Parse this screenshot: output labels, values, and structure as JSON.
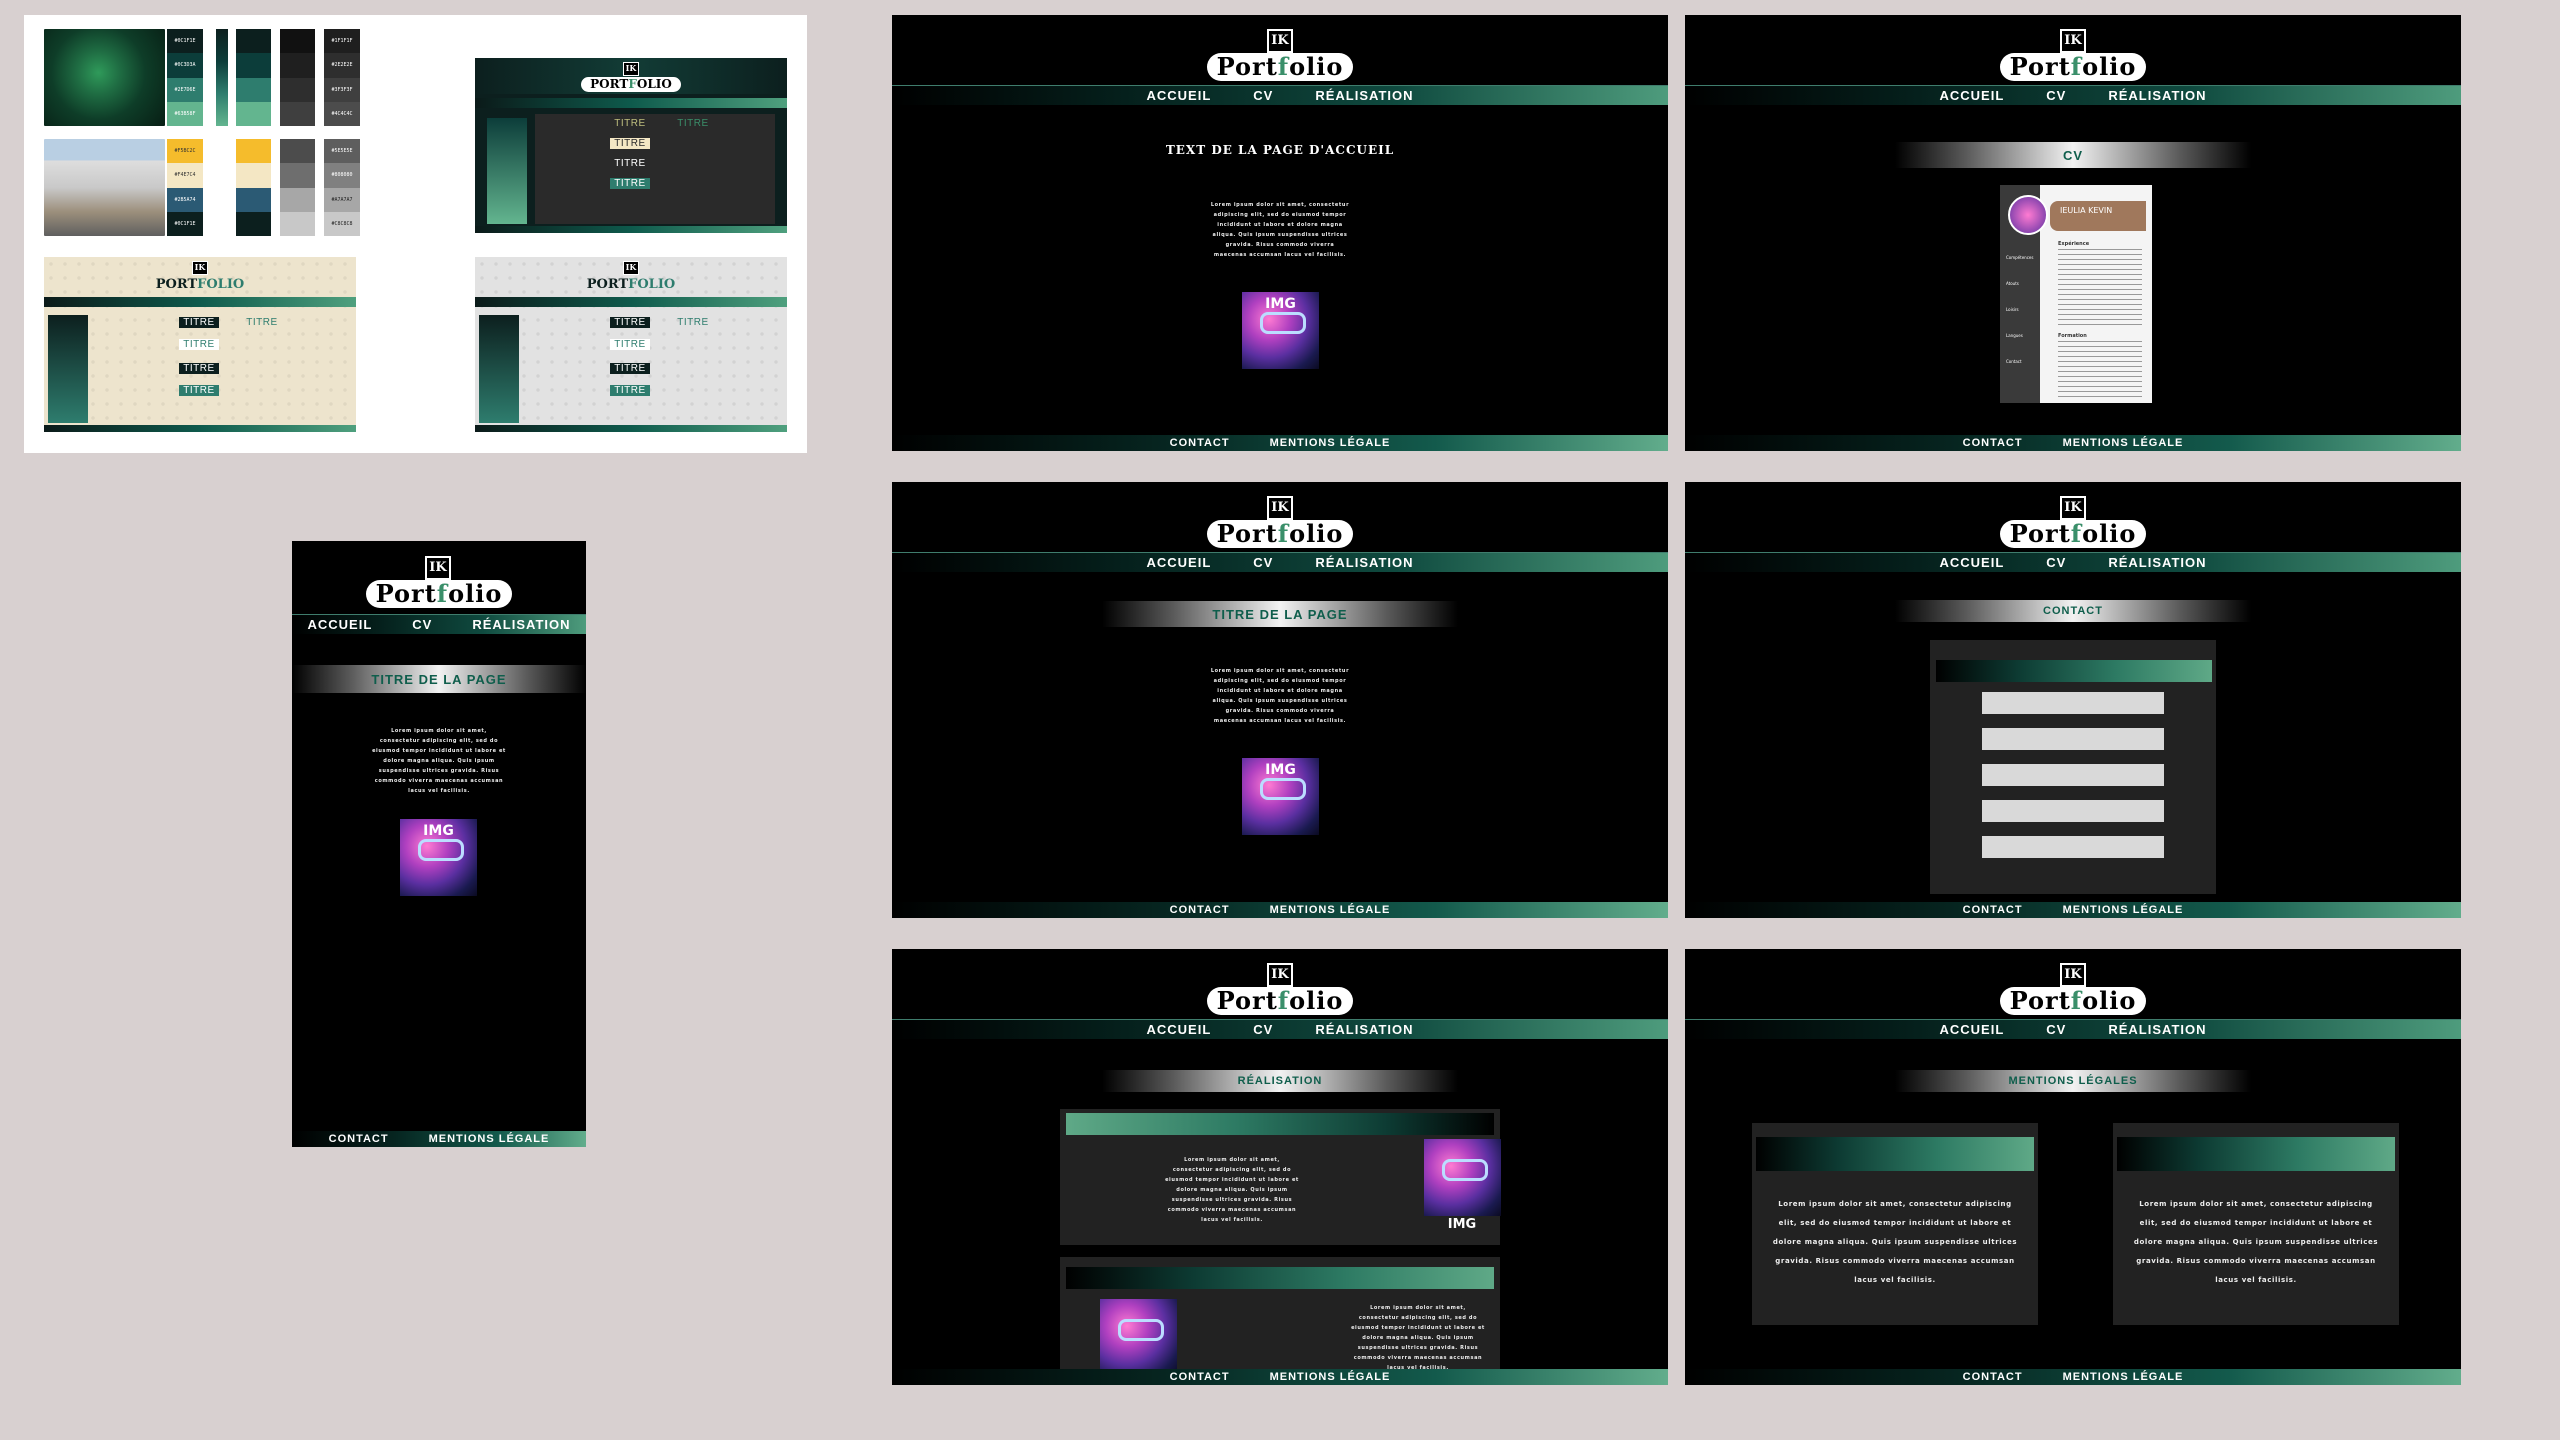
{
  "moodboard": {
    "palette_leaf_codes": [
      "#0C1F1E",
      "#0C3D3A",
      "#2E7D6E",
      "#63B58F"
    ],
    "palette_house_codes": [
      "#F5BC2C",
      "#F4E7C4",
      "#2B5A74",
      "#0C1F1E"
    ],
    "grey_codes_1": [
      "#1F1F1F",
      "#2E2E2E",
      "#3F3F3F",
      "#4C4C4C"
    ],
    "grey_codes_2": [
      "#5E5E5E",
      "#808080",
      "#A7A7A7",
      "#C8C8C8"
    ],
    "swatch_colors": {
      "green": [
        "#0c1f1e",
        "#0c3d3a",
        "#2e7d6e",
        "#63b58f"
      ],
      "gold": [
        "#f5bc2c",
        "#f4e7c4",
        "#2b5a74",
        "#0c1f1e"
      ],
      "grey1": [
        "#111111",
        "#1f1f1f",
        "#2e2e2e",
        "#3f3f3f"
      ],
      "grey2": [
        "#4c4c4c",
        "#6e6e6e",
        "#a7a7a7",
        "#c8c8c8"
      ]
    },
    "mini_dark_titles": [
      "TITRE",
      "TITRE",
      "TITRE",
      "TITRE"
    ],
    "mini_light_logo": "Portfolio",
    "mini_light_titles": [
      "TITRE",
      "TITRE",
      "TITRE",
      "TITRE",
      "TITRE"
    ],
    "logo_initials": "IK"
  },
  "site": {
    "logo_initials": "IK",
    "logo_word_a": "Port",
    "logo_word_b": "f",
    "logo_word_c": "olio",
    "nav": [
      "ACCUEIL",
      "CV",
      "RÉALISATION"
    ],
    "footer": [
      "CONTACT",
      "MENTIONS LÉGALE"
    ],
    "img_label": "IMG",
    "lorem_short": "Lorem ipsum dolor sit amet, consectetur adipiscing elit, sed do eiusmod tempor incididunt ut labore et dolore magna aliqua. Quis ipsum suspendisse ultrices gravida. Risus commodo viverra maecenas accumsan lacus vel facilisis."
  },
  "pages": {
    "home": {
      "heading": "TEXT DE LA PAGE D'ACCUEIL"
    },
    "cv": {
      "title": "CV",
      "name": "IEULIA KEVIN",
      "sections_left": [
        "Compétences",
        "Atouts",
        "Loisirs",
        "Langues",
        "Contact"
      ],
      "sections_right": [
        "Expérience",
        "Formation"
      ]
    },
    "generic": {
      "title": "TITRE DE LA PAGE"
    },
    "contact": {
      "title": "CONTACT"
    },
    "realisation": {
      "title": "RÉALISATION"
    },
    "legal": {
      "title": "MENTIONS LÉGALES"
    },
    "mobile": {
      "title": "TITRE DE LA PAGE",
      "footer": [
        "CONTACT",
        "MENTIONS LÉGALE"
      ]
    }
  }
}
